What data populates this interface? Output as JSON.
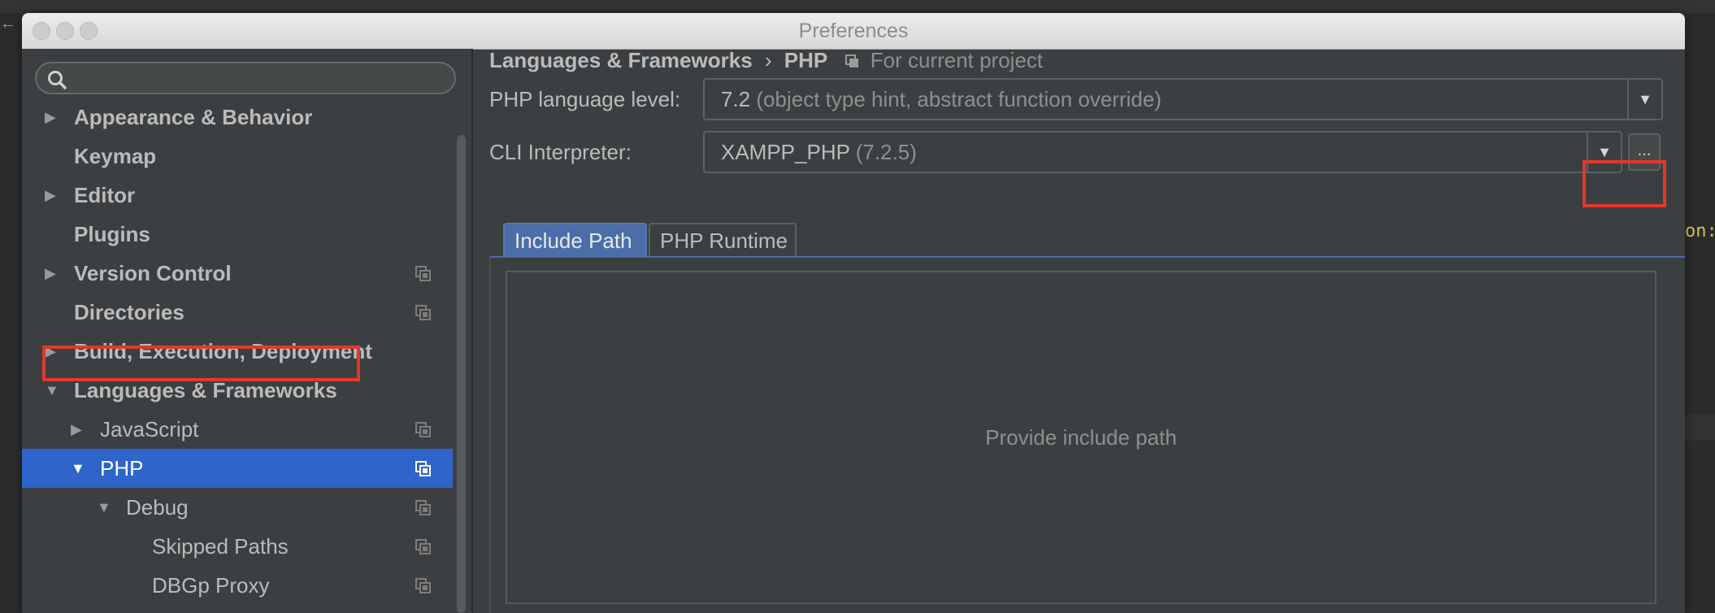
{
  "window": {
    "title": "Preferences"
  },
  "search": {
    "placeholder": "",
    "value": ""
  },
  "sidebar": {
    "items": [
      {
        "label": "Appearance & Behavior",
        "expander": "▶",
        "bold": true
      },
      {
        "label": "Keymap",
        "expander": "",
        "bold": true
      },
      {
        "label": "Editor",
        "expander": "▶",
        "bold": true
      },
      {
        "label": "Plugins",
        "expander": "",
        "bold": true
      },
      {
        "label": "Version Control",
        "expander": "▶",
        "bold": true,
        "project_icon": true
      },
      {
        "label": "Directories",
        "expander": "",
        "bold": true,
        "project_icon": true
      },
      {
        "label": "Build, Execution, Deployment",
        "expander": "▶",
        "bold": true
      },
      {
        "label": "Languages & Frameworks",
        "expander": "▼",
        "bold": true
      },
      {
        "label": "JavaScript",
        "expander": "▶",
        "bold": false,
        "project_icon": true
      },
      {
        "label": "PHP",
        "expander": "▼",
        "bold": false,
        "project_icon": true,
        "selected": true
      },
      {
        "label": "Debug",
        "expander": "▼",
        "bold": false,
        "project_icon": true
      },
      {
        "label": "Skipped Paths",
        "expander": "",
        "bold": false,
        "project_icon": true
      },
      {
        "label": "DBGp Proxy",
        "expander": "",
        "bold": false,
        "project_icon": true
      }
    ]
  },
  "breadcrumb": {
    "parent": "Languages & Frameworks",
    "separator": "›",
    "current": "PHP",
    "scope": "For current project"
  },
  "php_settings": {
    "language_level_label": "PHP language level:",
    "language_level_value": "7.2",
    "language_level_desc": "(object type hint, abstract function override)",
    "cli_label": "CLI Interpreter:",
    "cli_value": "XAMPP_PHP",
    "cli_version": "(7.2.5)",
    "dropdown_glyph": "▼",
    "more_button_label": "..."
  },
  "tabs": [
    {
      "label": "Include Path",
      "active": true
    },
    {
      "label": "PHP Runtime",
      "active": false
    }
  ],
  "include_path": {
    "empty_text": "Provide include path"
  },
  "background": {
    "right_code_fragment": "on:"
  },
  "colors": {
    "selection": "#2f65ca",
    "highlight_annotation": "#e2382b",
    "active_tab": "#4b6ea9",
    "panel_bg": "#3c3f41"
  },
  "icons": {
    "search": "search-icon",
    "project_scope": "project-scope-icon",
    "tree_expand": "triangle-right-icon",
    "tree_collapse": "triangle-down-icon"
  }
}
